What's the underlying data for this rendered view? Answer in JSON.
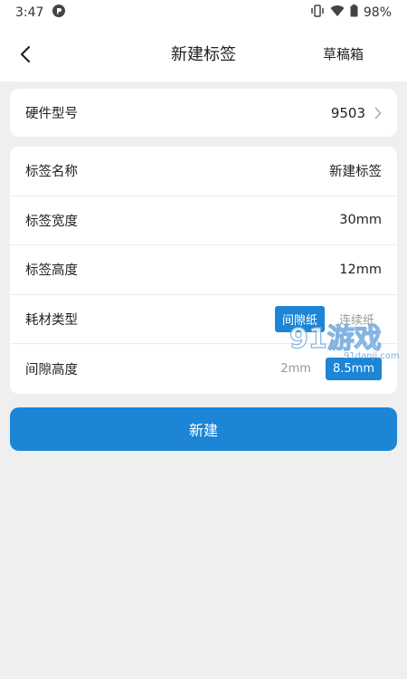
{
  "status": {
    "time": "3:47",
    "battery": "98%"
  },
  "header": {
    "title": "新建标签",
    "drafts_label": "草稿箱"
  },
  "hardware": {
    "label": "硬件型号",
    "value": "9503"
  },
  "form": {
    "name": {
      "label": "标签名称",
      "value": "新建标签"
    },
    "width": {
      "label": "标签宽度",
      "value": "30mm"
    },
    "height": {
      "label": "标签高度",
      "value": "12mm"
    },
    "material": {
      "label": "耗材类型",
      "options": [
        "间隙纸",
        "连续纸"
      ],
      "selected_index": 0
    },
    "gap": {
      "label": "间隙高度",
      "options": [
        "2mm",
        "8.5mm"
      ],
      "selected_index": 1
    }
  },
  "actions": {
    "create_label": "新建"
  },
  "watermark": {
    "logo_text": "91游戏",
    "url": "91danji.com"
  },
  "colors": {
    "accent": "#1c85d6",
    "background": "#efefef"
  }
}
